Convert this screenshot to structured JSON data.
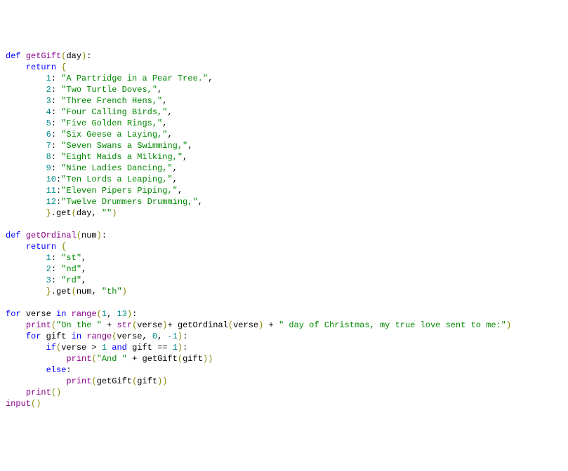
{
  "code": {
    "indent1": "    ",
    "indent2": "        ",
    "indent3": "            ",
    "kw_def": "def",
    "kw_return": "return",
    "kw_for": "for",
    "kw_in": "in",
    "kw_if": "if",
    "kw_else": "else",
    "kw_and": "and",
    "fn_getGift": "getGift",
    "fn_getOrdinal": "getOrdinal",
    "fn_range": "range",
    "fn_print": "print",
    "fn_input": "input",
    "id_day": "day",
    "id_num": "num",
    "id_verse": "verse",
    "id_gift": "gift",
    "id_str": "str",
    "op_get": ".get",
    "paren_open": "(",
    "paren_close": ")",
    "brace_open": "{",
    "brace_close": "}",
    "sep_comma": ", ",
    "colon": ":",
    "colon_sp": ": ",
    "comma_trail": ",",
    "sp": " ",
    "gt": " > ",
    "eqeq": " == ",
    "plus": " + ",
    "plus_tight_r": "+ ",
    "nums": {
      "n0": "0",
      "n1": "1",
      "n2": "2",
      "n3": "3",
      "n4": "4",
      "n5": "5",
      "n6": "6",
      "n7": "7",
      "n8": "8",
      "n9": "9",
      "n10": "10",
      "n11": "11",
      "n12": "12",
      "n13": "13",
      "nneg1": "-1"
    },
    "gifts": {
      "g1": "\"A Partridge in a Pear Tree.\"",
      "g2": "\"Two Turtle Doves,\"",
      "g3": "\"Three French Hens,\"",
      "g4": "\"Four Calling Birds,\"",
      "g5": "\"Five Golden Rings,\"",
      "g6": "\"Six Geese a Laying,\"",
      "g7": "\"Seven Swans a Swimming,\"",
      "g8": "\"Eight Maids a Milking,\"",
      "g9": "\"Nine Ladies Dancing,\"",
      "g10": "\"Ten Lords a Leaping,\"",
      "g11": "\"Eleven Pipers Piping,\"",
      "g12": "\"Twelve Drummers Drumming,\""
    },
    "ord": {
      "st": "\"st\"",
      "nd": "\"nd\"",
      "rd": "\"rd\"",
      "th": "\"th\""
    },
    "strs": {
      "empty": "\"\"",
      "on_the": "\"On the \"",
      "day_of": "\" day of Christmas, my true love sent to me:\"",
      "and_sp": "\"And \" "
    }
  }
}
